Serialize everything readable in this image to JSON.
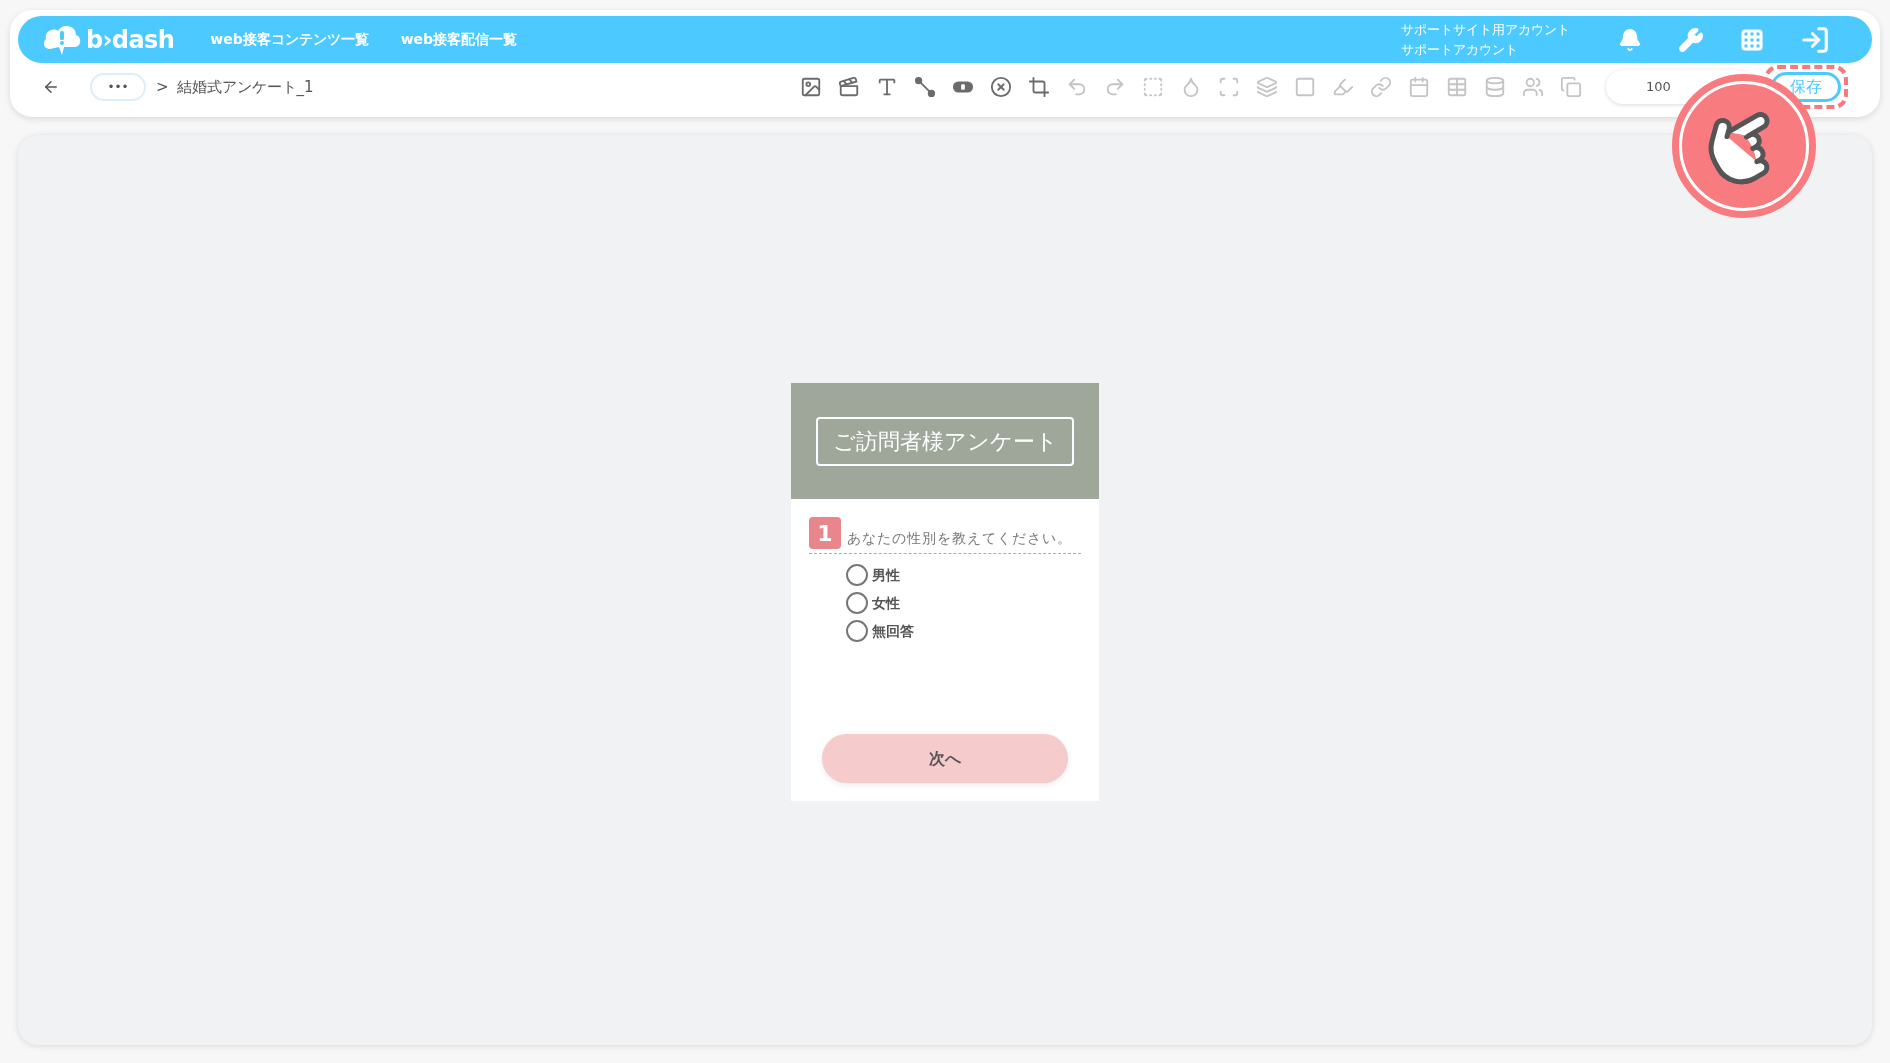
{
  "header": {
    "logo": "b›dash",
    "nav": [
      "web接客コンテンツ一覧",
      "web接客配信一覧"
    ],
    "account": [
      "サポートサイト用アカウント",
      "サポートアカウント"
    ]
  },
  "breadcrumb": {
    "more": "•••",
    "separator": ">",
    "current": "結婚式アンケート_1"
  },
  "toolbar": [
    {
      "disabled": false
    },
    {
      "disabled": false
    },
    {
      "disabled": false
    },
    {
      "disabled": false
    },
    {
      "disabled": false
    },
    {
      "disabled": false
    },
    {
      "disabled": false
    },
    {
      "disabled": true
    },
    {
      "disabled": true
    },
    {
      "disabled": true
    },
    {
      "disabled": true
    },
    {
      "disabled": true
    },
    {
      "disabled": true
    },
    {
      "disabled": true
    },
    {
      "disabled": true
    },
    {
      "disabled": true
    },
    {
      "disabled": true
    },
    {
      "disabled": true
    },
    {
      "disabled": true
    },
    {
      "disabled": true
    },
    {
      "disabled": true
    }
  ],
  "zoom": "100",
  "save_button": "保存",
  "survey": {
    "title": "ご訪問者様アンケート",
    "question_number": "1",
    "question": "あなたの性別を教えてください。",
    "options": [
      {
        "label": "男性",
        "selected": false
      },
      {
        "label": "女性",
        "selected": false
      },
      {
        "label": "無回答",
        "selected": false
      }
    ],
    "next_button": "次へ"
  }
}
